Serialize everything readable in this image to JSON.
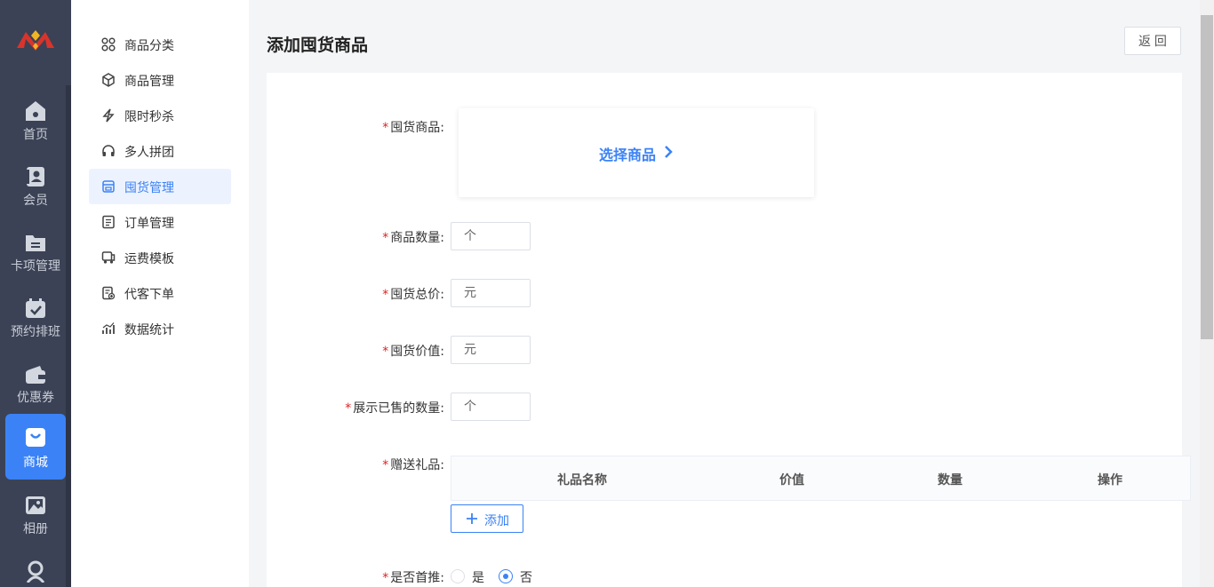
{
  "rail": {
    "items": [
      {
        "label": "首页",
        "icon": "home-icon"
      },
      {
        "label": "会员",
        "icon": "member-card-icon"
      },
      {
        "label": "卡项管理",
        "icon": "folder-icon"
      },
      {
        "label": "预约排班",
        "icon": "calendar-check-icon"
      },
      {
        "label": "优惠券",
        "icon": "wallet-icon"
      },
      {
        "label": "商城",
        "icon": "shopping-bag-icon",
        "active": true
      },
      {
        "label": "相册",
        "icon": "gallery-icon"
      },
      {
        "label": "",
        "icon": "user-group-icon"
      }
    ]
  },
  "submenu": {
    "items": [
      {
        "label": "商品分类",
        "icon": "grid-icon"
      },
      {
        "label": "商品管理",
        "icon": "box-icon"
      },
      {
        "label": "限时秒杀",
        "icon": "lightning-icon"
      },
      {
        "label": "多人拼团",
        "icon": "headset-icon"
      },
      {
        "label": "囤货管理",
        "icon": "store-icon",
        "active": true
      },
      {
        "label": "订单管理",
        "icon": "order-list-icon"
      },
      {
        "label": "运费模板",
        "icon": "truck-icon"
      },
      {
        "label": "代客下单",
        "icon": "proxy-order-icon"
      },
      {
        "label": "数据统计",
        "icon": "bar-chart-icon"
      }
    ]
  },
  "page": {
    "title": "添加囤货商品",
    "back_label": "返 回"
  },
  "form": {
    "product_label": "囤货商品:",
    "select_product_label": "选择商品",
    "quantity_label": "商品数量:",
    "quantity_placeholder": "个",
    "total_price_label": "囤货总价:",
    "total_price_placeholder": "元",
    "value_label": "囤货价值:",
    "value_placeholder": "元",
    "sold_count_label": "展示已售的数量:",
    "sold_count_placeholder": "个",
    "gift_label": "赠送礼品:",
    "gift_table": {
      "headers": [
        "礼品名称",
        "价值",
        "数量",
        "操作"
      ]
    },
    "add_label": "添加",
    "featured_label": "是否首推:",
    "featured_options": [
      "是",
      "否"
    ],
    "featured_selected": "否"
  },
  "colors": {
    "accent": "#3b82f6",
    "rail_bg": "#3b4255",
    "required": "#e02020"
  }
}
